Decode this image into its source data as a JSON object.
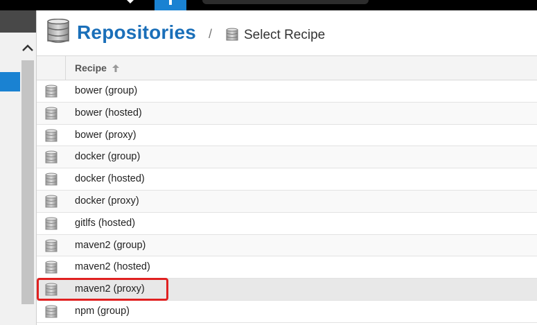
{
  "header": {
    "title": "Repositories",
    "breadcrumb_separator": "/",
    "breadcrumb_current": "Select Recipe"
  },
  "table": {
    "column_header": "Recipe",
    "sort": "ascending",
    "rows": [
      {
        "label": "bower (group)"
      },
      {
        "label": "bower (hosted)"
      },
      {
        "label": "bower (proxy)"
      },
      {
        "label": "docker (group)"
      },
      {
        "label": "docker (hosted)"
      },
      {
        "label": "docker (proxy)"
      },
      {
        "label": "gitlfs (hosted)"
      },
      {
        "label": "maven2 (group)"
      },
      {
        "label": "maven2 (hosted)"
      },
      {
        "label": "maven2 (proxy)"
      },
      {
        "label": "npm (group)"
      }
    ],
    "highlighted_row": "maven2 (proxy)"
  },
  "colors": {
    "accent": "#1a82d2",
    "title": "#1a6fb9",
    "highlight": "#e02020"
  },
  "icons": {
    "row_icon": "database-icon",
    "sort_icon": "sort-up-arrow-icon"
  }
}
